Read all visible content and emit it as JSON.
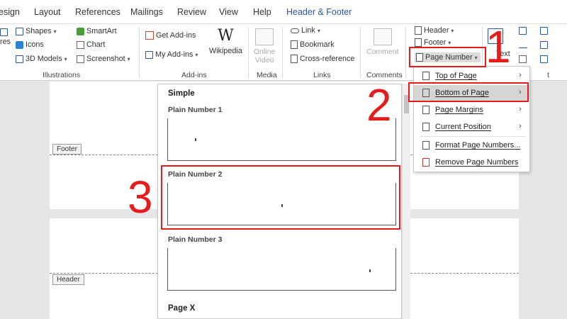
{
  "tabs": [
    {
      "label": "esign",
      "active": false
    },
    {
      "label": "Layout",
      "active": false
    },
    {
      "label": "References",
      "active": false
    },
    {
      "label": "Mailings",
      "active": false
    },
    {
      "label": "Review",
      "active": false
    },
    {
      "label": "View",
      "active": false
    },
    {
      "label": "Help",
      "active": false
    },
    {
      "label": "Header & Footer",
      "active": true
    }
  ],
  "ribbon": {
    "illustrations": {
      "pictures_fragment": "ures",
      "shapes": "Shapes",
      "icons": "Icons",
      "models": "3D Models",
      "smartart": "SmartArt",
      "chart": "Chart",
      "screenshot": "Screenshot",
      "label": "Illustrations"
    },
    "addins": {
      "get_addins": "Get Add-ins",
      "my_addins": "My Add-ins",
      "wikipedia": "Wikipedia",
      "label": "Add-ins"
    },
    "media": {
      "online_video_1": "Online",
      "online_video_2": "Video",
      "label": "Media"
    },
    "links": {
      "link": "Link",
      "bookmark": "Bookmark",
      "cross_reference": "Cross-reference",
      "label": "Links"
    },
    "comments": {
      "comment": "Comment",
      "label": "Comments"
    },
    "header_footer": {
      "header": "Header",
      "footer": "Footer",
      "page_number": "Page Number"
    },
    "text_fragment": "Text",
    "t_fragment": "t"
  },
  "document": {
    "footer_tag": "Footer",
    "header_tag": "Header"
  },
  "gallery": {
    "section_simple": "Simple",
    "items": [
      {
        "label": "Plain Number 1"
      },
      {
        "label": "Plain Number 2"
      },
      {
        "label": "Plain Number 3"
      }
    ],
    "section_pagex": "Page X"
  },
  "submenu": {
    "items": [
      {
        "label": "Top of Page",
        "has_arrow": true
      },
      {
        "label": "Bottom of Page",
        "has_arrow": true
      },
      {
        "label": "Page Margins",
        "has_arrow": true
      },
      {
        "label": "Current Position",
        "has_arrow": true
      },
      {
        "label": "Format Page Numbers...",
        "has_arrow": false
      },
      {
        "label": "Remove Page Numbers",
        "has_arrow": false
      }
    ],
    "highlighted_index": 1
  },
  "annotations": {
    "step1": "1",
    "step2": "2",
    "step3": "3",
    "color": "#e61c1c"
  },
  "colors": {
    "accent": "#2b579a",
    "highlight": "#d5d5d5"
  }
}
